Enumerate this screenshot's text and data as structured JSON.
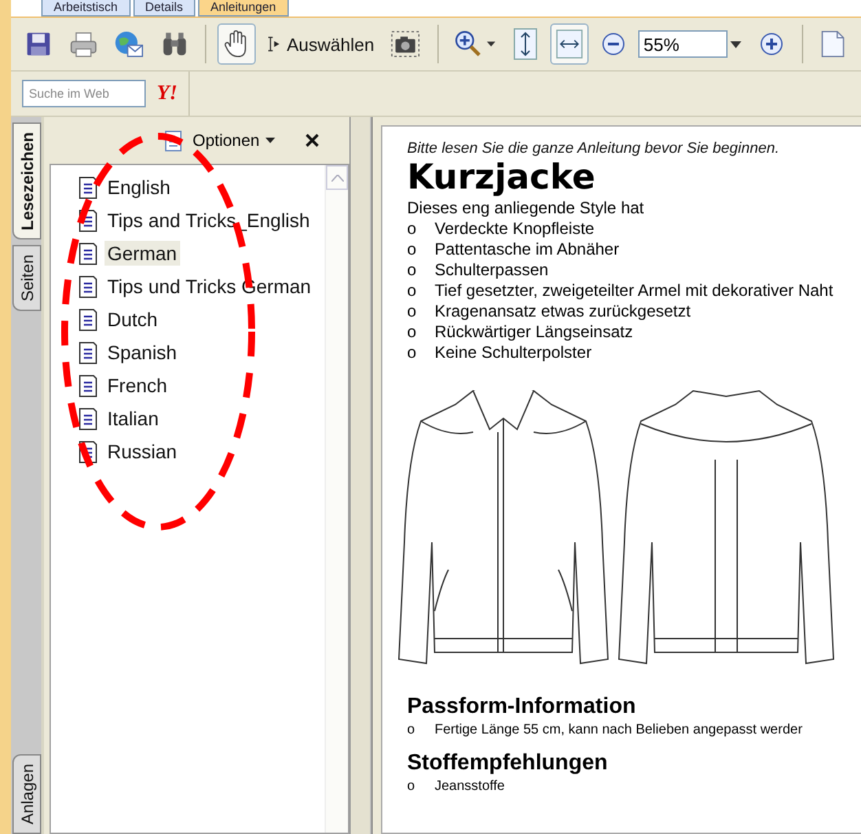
{
  "window_tabs": [
    {
      "label": "Arbeitstisch",
      "selected": false
    },
    {
      "label": "Details",
      "selected": false
    },
    {
      "label": "Anleitungen",
      "selected": true
    }
  ],
  "toolbar": {
    "items": [
      {
        "kind": "save"
      },
      {
        "kind": "print"
      },
      {
        "kind": "email"
      },
      {
        "kind": "find"
      },
      {
        "kind": "hand",
        "pressed": true
      },
      {
        "kind": "select",
        "label": "Auswählen"
      },
      {
        "kind": "snapshot"
      },
      {
        "kind": "zoom"
      },
      {
        "kind": "fit-page"
      },
      {
        "kind": "fit-width",
        "pressed": true
      },
      {
        "kind": "zoom-out"
      },
      {
        "kind": "zoom-field",
        "value": "55%"
      },
      {
        "kind": "zoom-in"
      },
      {
        "kind": "page"
      }
    ]
  },
  "search": {
    "placeholder": "Suche im Web",
    "logo": "Y!"
  },
  "side_tabs": [
    {
      "label": "Lesezeichen",
      "selected": true
    },
    {
      "label": "Seiten",
      "selected": false
    },
    {
      "label": "Anlagen",
      "selected": false
    }
  ],
  "bookmarks": {
    "options_label": "Optionen",
    "items": [
      {
        "label": "English",
        "selected": false
      },
      {
        "label": "Tips and Tricks_English",
        "selected": false
      },
      {
        "label": "German",
        "selected": true
      },
      {
        "label": "Tips und Tricks German",
        "selected": false
      },
      {
        "label": "Dutch",
        "selected": false
      },
      {
        "label": "Spanish",
        "selected": false
      },
      {
        "label": "French",
        "selected": false
      },
      {
        "label": "Italian",
        "selected": false
      },
      {
        "label": "Russian",
        "selected": false
      }
    ]
  },
  "document": {
    "note": "Bitte lesen Sie die ganze Anleitung bevor Sie beginnen.",
    "title": "Kurzjacke",
    "intro": "Dieses eng anliegende Style hat",
    "features": [
      {
        "bullet": "o",
        "text": "Verdeckte Knopfleiste"
      },
      {
        "bullet": "o",
        "text": "Pattentasche im Abnäher"
      },
      {
        "bullet": "o",
        "text": "Schulterpassen"
      },
      {
        "bullet": "o",
        "text": "Tief gesetzter, zweigeteilter Armel mit dekorativer Naht"
      },
      {
        "bullet": "o",
        "text": "Kragenansatz etwas zurückgesetzt"
      },
      {
        "bullet": "o",
        "text": "Rückwärtiger Längseinsatz"
      },
      {
        "bullet": "o",
        "text": "Keine Schulterpolster"
      }
    ],
    "sections": [
      {
        "heading": "Passform-Information",
        "items": [
          {
            "bullet": "o",
            "text": "Fertige Länge 55 cm, kann nach Belieben angepasst werder"
          }
        ]
      },
      {
        "heading": "Stoffempfehlungen",
        "items": [
          {
            "bullet": "o",
            "text": "Jeansstoffe"
          }
        ]
      }
    ]
  }
}
